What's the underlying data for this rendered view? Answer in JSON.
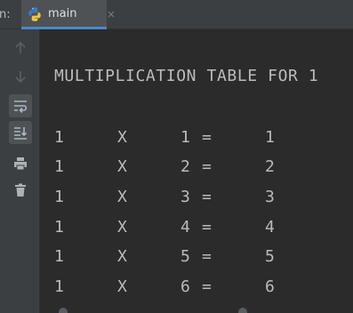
{
  "run_panel": {
    "prefix": "n:",
    "tab": {
      "label": "main",
      "close_glyph": "×",
      "icon": "python-icon"
    }
  },
  "toolbar": {
    "buttons": [
      {
        "name": "up-arrow-icon",
        "state": "disabled"
      },
      {
        "name": "down-arrow-icon",
        "state": "disabled"
      },
      {
        "name": "soft-wrap-icon",
        "state": "active"
      },
      {
        "name": "scroll-to-end-icon",
        "state": "active"
      },
      {
        "name": "print-icon",
        "state": "normal"
      },
      {
        "name": "trash-icon",
        "state": "normal"
      }
    ]
  },
  "console": {
    "heading": "MULTIPLICATION TABLE FOR 1",
    "rows": [
      {
        "a": "1",
        "op": "X",
        "b": "1",
        "eq": "=",
        "result": "1"
      },
      {
        "a": "1",
        "op": "X",
        "b": "2",
        "eq": "=",
        "result": "2"
      },
      {
        "a": "1",
        "op": "X",
        "b": "3",
        "eq": "=",
        "result": "3"
      },
      {
        "a": "1",
        "op": "X",
        "b": "4",
        "eq": "=",
        "result": "4"
      },
      {
        "a": "1",
        "op": "X",
        "b": "5",
        "eq": "=",
        "result": "5"
      },
      {
        "a": "1",
        "op": "X",
        "b": "6",
        "eq": "=",
        "result": "6"
      }
    ]
  },
  "colors": {
    "background": "#2b2b2b",
    "panel": "#3c3f41",
    "text": "#bbbbbb",
    "accent": "#4a88c7"
  }
}
